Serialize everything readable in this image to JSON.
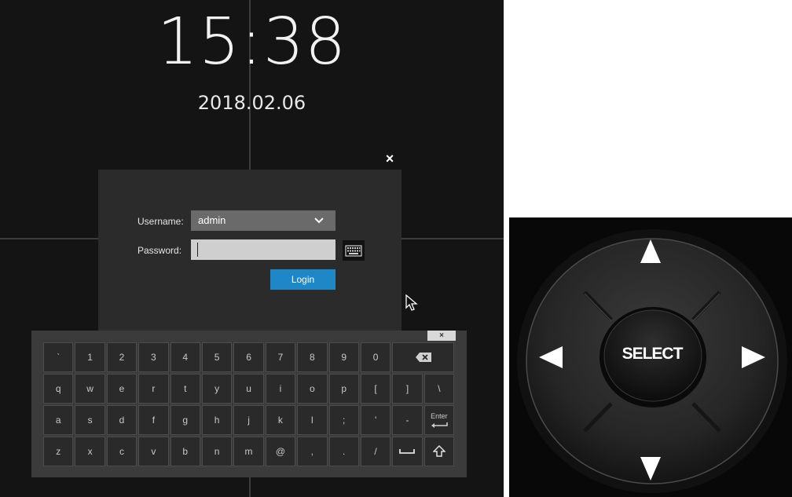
{
  "clock": {
    "time": "15:38",
    "date": "2018.02.06"
  },
  "login": {
    "username_label": "Username:",
    "username_value": "admin",
    "password_label": "Password:",
    "password_value": "",
    "login_button": "Login",
    "close_symbol": "×"
  },
  "keyboard": {
    "close_symbol": "×",
    "rows": [
      [
        "`",
        "1",
        "2",
        "3",
        "4",
        "5",
        "6",
        "7",
        "8",
        "9",
        "0"
      ],
      [
        "q",
        "w",
        "e",
        "r",
        "t",
        "y",
        "u",
        "i",
        "o",
        "p",
        "[",
        "]",
        "\\"
      ],
      [
        "a",
        "s",
        "d",
        "f",
        "g",
        "h",
        "j",
        "k",
        "l",
        ";",
        "'",
        "-"
      ],
      [
        "z",
        "x",
        "c",
        "v",
        "b",
        "n",
        "m",
        "@",
        ",",
        ".",
        "/"
      ]
    ],
    "enter_label": "Enter",
    "icons": {
      "backspace": "backspace-icon",
      "enter": "enter-icon",
      "space": "space-icon",
      "shift": "shift-icon"
    }
  },
  "remote": {
    "select_label": "SELECT",
    "icons": [
      "arrow-up-icon",
      "arrow-left-icon",
      "arrow-right-icon",
      "arrow-down-icon"
    ]
  },
  "colors": {
    "login_button": "#1e87c8",
    "screen_bg": "#141414",
    "dialog_bg": "#2b2b2b"
  }
}
